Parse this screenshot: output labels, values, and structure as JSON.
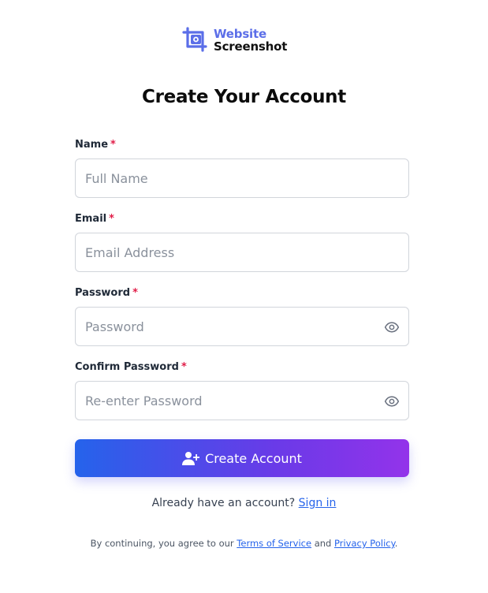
{
  "brand": {
    "line1": "Website",
    "line2": "Screenshot",
    "accent_color": "#5b6ee8",
    "icon": "crop-camera-icon"
  },
  "page": {
    "title": "Create Your Account"
  },
  "form": {
    "required_marker": "*",
    "fields": [
      {
        "label": "Name",
        "placeholder": "Full Name",
        "value": "",
        "type": "text"
      },
      {
        "label": "Email",
        "placeholder": "Email Address",
        "value": "",
        "type": "email"
      },
      {
        "label": "Password",
        "placeholder": "Password",
        "value": "",
        "type": "password",
        "icon": "eye-icon"
      },
      {
        "label": "Confirm Password",
        "placeholder": "Re-enter Password",
        "value": "",
        "type": "password",
        "icon": "eye-icon"
      }
    ],
    "submit": {
      "label": "Create Account",
      "icon": "user-plus-icon",
      "gradient": [
        "#2563eb",
        "#9333ea"
      ]
    }
  },
  "signin": {
    "prompt": "Already have an account?",
    "link": "Sign in"
  },
  "legal": {
    "prefix": "By continuing, you agree to our",
    "terms_link": "Terms of Service",
    "conjunction": "and",
    "privacy_link": "Privacy Policy",
    "suffix": "."
  }
}
